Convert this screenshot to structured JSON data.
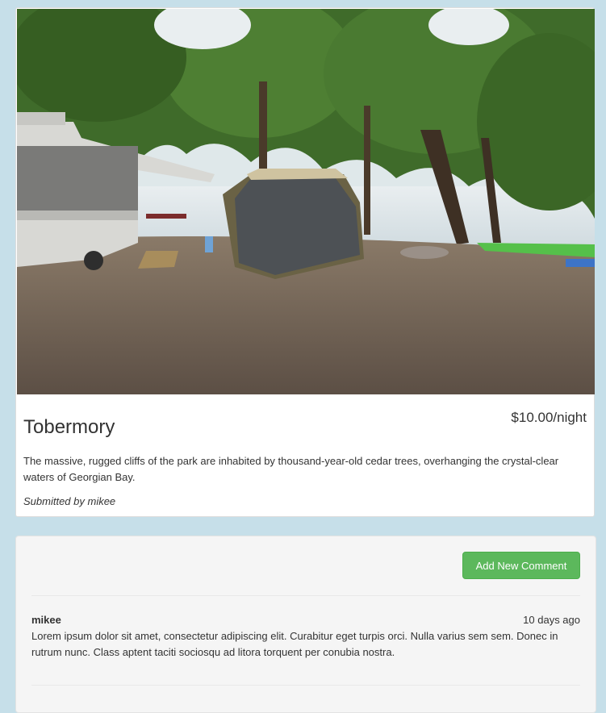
{
  "campground": {
    "name": "Tobermory",
    "price": "$10.00/night",
    "description": "The massive, rugged cliffs of the park are inhabited by thousand-year-old cedar trees, overhanging the crystal-clear waters of Georgian Bay.",
    "submitted_by": "Submitted by mikee"
  },
  "comments_panel": {
    "add_button_label": "Add New Comment",
    "comments": [
      {
        "author": "mikee",
        "time": "10 days ago",
        "text": "Lorem ipsum dolor sit amet, consectetur adipiscing elit. Curabitur eget turpis orci. Nulla varius sem sem. Donec in rutrum nunc. Class aptent taciti sociosqu ad litora torquent per conubia nostra."
      }
    ]
  }
}
